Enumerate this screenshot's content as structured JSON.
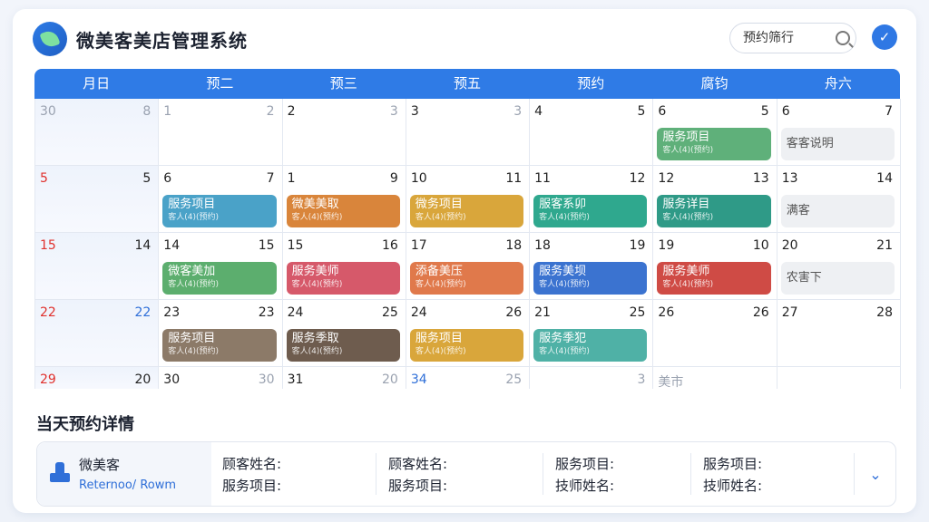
{
  "app": {
    "title": "微美客美店管理系统"
  },
  "header": {
    "search_value": "预约筛行",
    "confirm_icon": "✓"
  },
  "calendar": {
    "weekdays": [
      "月日",
      "预二",
      "预三",
      "预五",
      "预约",
      "腐钧",
      "舟六"
    ],
    "rows": [
      [
        {
          "l": "30",
          "r": "8",
          "lc": "muted",
          "rc": "muted",
          "bg": "faded"
        },
        {
          "l": "1",
          "r": "2",
          "lc": "muted",
          "rc": "muted"
        },
        {
          "l": "2",
          "r": "3",
          "rc": "muted"
        },
        {
          "l": "3",
          "r": "3",
          "rc": "muted"
        },
        {
          "l": "4",
          "r": "5"
        },
        {
          "l": "6",
          "r": "5",
          "appt": {
            "title": "服务项目",
            "sub": "客人(4)(预约)",
            "color": "#5fb07a"
          }
        },
        {
          "l": "6",
          "r": "7",
          "appt": {
            "title": "客客说明",
            "sub": "",
            "color": "#eef0f3",
            "ghost": true
          }
        }
      ],
      [
        {
          "l": "5",
          "r": "5",
          "lc": "red",
          "bg": "faded"
        },
        {
          "l": "6",
          "r": "7",
          "appt": {
            "title": "服务项目",
            "sub": "客人(4)(预约)",
            "color": "#4aa2c8"
          }
        },
        {
          "l": "1",
          "r": "9",
          "appt": {
            "title": "微美美取",
            "sub": "客人(4)(预约)",
            "color": "#d9853b"
          }
        },
        {
          "l": "10",
          "r": "11",
          "appt": {
            "title": "微务项目",
            "sub": "客人(4)(预约)",
            "color": "#d9a63b"
          }
        },
        {
          "l": "11",
          "r": "12",
          "appt": {
            "title": "服客系卯",
            "sub": "客人(4)(预约)",
            "color": "#2fa88e"
          }
        },
        {
          "l": "12",
          "r": "13",
          "appt": {
            "title": "服务详目",
            "sub": "客人(4)(预约)",
            "color": "#2f9a87"
          }
        },
        {
          "l": "13",
          "r": "14",
          "appt": {
            "title": "满客",
            "sub": "",
            "color": "#eef0f3",
            "ghost": true
          }
        }
      ],
      [
        {
          "l": "15",
          "r": "14",
          "lc": "red",
          "bg": "faded"
        },
        {
          "l": "14",
          "r": "15",
          "appt": {
            "title": "微客美加",
            "sub": "客人(4)(预约)",
            "color": "#5cae6e"
          }
        },
        {
          "l": "15",
          "r": "16",
          "appt": {
            "title": "服务美师",
            "sub": "客人(4)(预约)",
            "color": "#d6596a"
          }
        },
        {
          "l": "17",
          "r": "18",
          "appt": {
            "title": "添备美压",
            "sub": "客人(4)(预约)",
            "color": "#e0794b"
          }
        },
        {
          "l": "18",
          "r": "19",
          "appt": {
            "title": "服务美坝",
            "sub": "客人(4)(预约)",
            "color": "#3b73d0"
          }
        },
        {
          "l": "19",
          "r": "10",
          "appt": {
            "title": "服务美师",
            "sub": "客人(4)(预约)",
            "color": "#cf4b45"
          }
        },
        {
          "l": "20",
          "r": "21",
          "appt": {
            "title": "农害下",
            "sub": "",
            "color": "#eef0f3",
            "ghost": true
          }
        }
      ],
      [
        {
          "l": "22",
          "r": "22",
          "lc": "red",
          "rc": "blue",
          "bg": "faded"
        },
        {
          "l": "23",
          "r": "23",
          "appt": {
            "title": "服务项目",
            "sub": "客人(4)(预约)",
            "color": "#8c7a68"
          }
        },
        {
          "l": "24",
          "r": "25",
          "appt": {
            "title": "服务季取",
            "sub": "客人(4)(预约)",
            "color": "#6e5c4e"
          }
        },
        {
          "l": "24",
          "r": "26",
          "appt": {
            "title": "服务项目",
            "sub": "客人(4)(预约)",
            "color": "#d9a63b"
          }
        },
        {
          "l": "21",
          "r": "25",
          "appt": {
            "title": "服务季犯",
            "sub": "客人(4)(预约)",
            "color": "#4fb1a6"
          }
        },
        {
          "l": "26",
          "r": "26"
        },
        {
          "l": "27",
          "r": "28"
        }
      ],
      [
        {
          "l": "29",
          "r": "20",
          "lc": "red",
          "bg": "faded"
        },
        {
          "l": "30",
          "r": "30",
          "rc": "muted"
        },
        {
          "l": "31",
          "r": "20",
          "rc": "muted"
        },
        {
          "l": "34",
          "r": "25",
          "lc": "blue",
          "rc": "muted"
        },
        {
          "l": "",
          "r": "3",
          "rc": "muted"
        },
        {
          "l": "美市",
          "r": "",
          "lc": "muted"
        },
        {
          "l": "",
          "r": ""
        }
      ]
    ]
  },
  "details": {
    "section_title": "当天预约详情",
    "store_name": "微美客",
    "store_sub": "Reternoo/ Rowm",
    "columns": [
      [
        "顾客姓名:",
        "服务项目:"
      ],
      [
        "顾客姓名:",
        "服务项目:"
      ],
      [
        "服务项目:",
        "技师姓名:"
      ],
      [
        "服务项目:",
        "技师姓名:"
      ]
    ],
    "expand_icon": "⌄"
  }
}
